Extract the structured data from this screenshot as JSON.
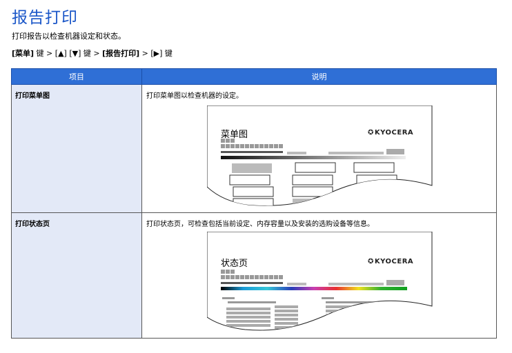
{
  "page_title": "报告打印",
  "description": "打印报告以检查机器设定和状态。",
  "nav_path": {
    "k1": "[菜单]",
    "t1": " 键 > [",
    "up": "▲",
    "t2": "] [",
    "down": "▼",
    "t3": "] 键 > ",
    "k2": "[报告打印]",
    "t4": " > [",
    "right": "▶",
    "t5": "] 键"
  },
  "table": {
    "headers": [
      "项目",
      "说明"
    ],
    "rows": [
      {
        "item": "打印菜单图",
        "explanation": "打印菜单图以检查机器的设定。",
        "sample_title": "菜单图",
        "logo": "KYOCERA",
        "logo_mark": "✪"
      },
      {
        "item": "打印状态页",
        "explanation": "打印状态页，可检查包括当前设定、内存容量以及安装的选购设备等信息。",
        "sample_title": "状态页",
        "logo": "KYOCERA",
        "logo_mark": "✪"
      }
    ]
  },
  "colors": {
    "title": "#1a56c8",
    "header_bg": "#2f6fd6",
    "item_bg": "#e3e9f7"
  }
}
